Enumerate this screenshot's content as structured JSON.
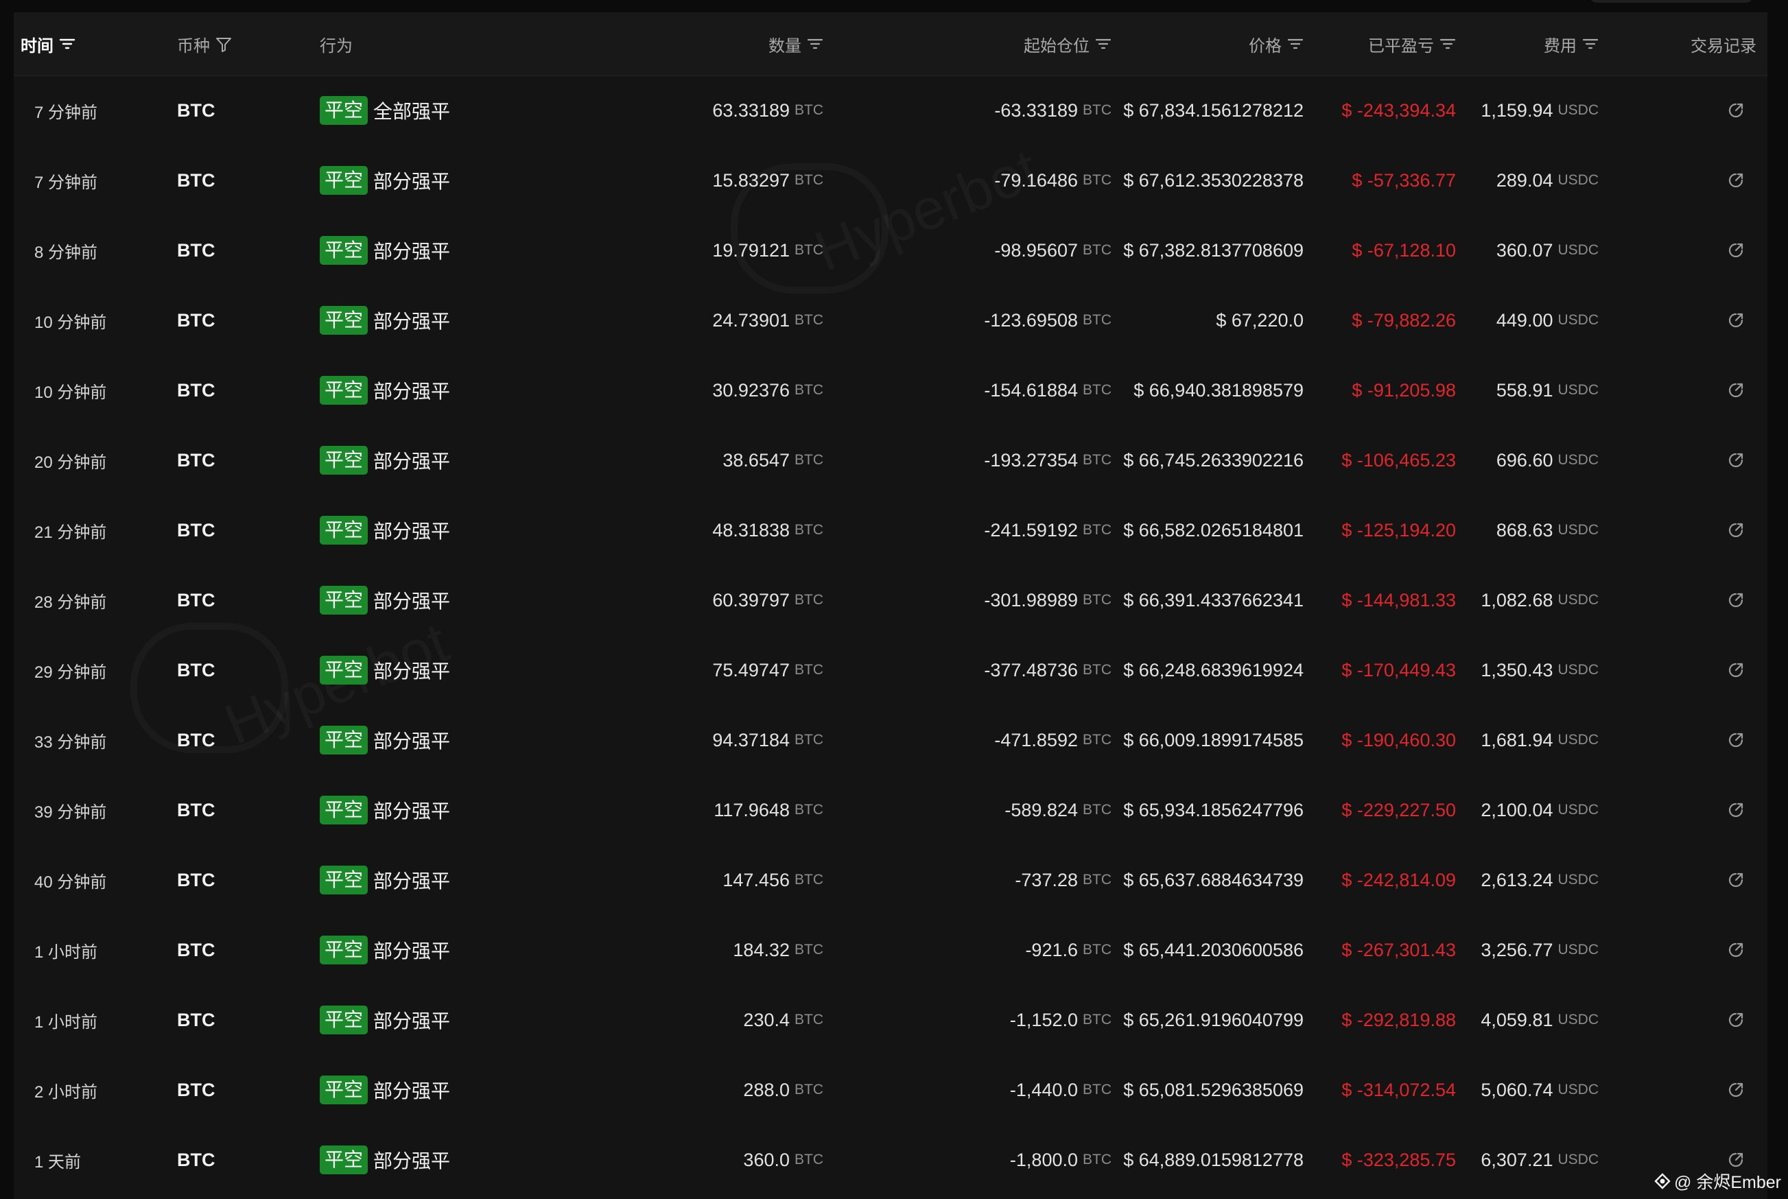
{
  "header": {
    "time": "时间",
    "coin": "币种",
    "action": "行为",
    "qty": "数量",
    "start_pos": "起始仓位",
    "price": "价格",
    "pnl": "已平盈亏",
    "fee": "费用",
    "trade_log": "交易记录"
  },
  "rows": [
    {
      "time": "7 分钟前",
      "coin": "BTC",
      "badge": "平空",
      "action": "全部强平",
      "qty": "63.33189",
      "qty_unit": "BTC",
      "start": "-63.33189",
      "start_unit": "BTC",
      "price": "$ 67,834.1561278212",
      "pnl": "$ -243,394.34",
      "fee": "1,159.94",
      "fee_unit": "USDC"
    },
    {
      "time": "7 分钟前",
      "coin": "BTC",
      "badge": "平空",
      "action": "部分强平",
      "qty": "15.83297",
      "qty_unit": "BTC",
      "start": "-79.16486",
      "start_unit": "BTC",
      "price": "$ 67,612.3530228378",
      "pnl": "$ -57,336.77",
      "fee": "289.04",
      "fee_unit": "USDC"
    },
    {
      "time": "8 分钟前",
      "coin": "BTC",
      "badge": "平空",
      "action": "部分强平",
      "qty": "19.79121",
      "qty_unit": "BTC",
      "start": "-98.95607",
      "start_unit": "BTC",
      "price": "$ 67,382.8137708609",
      "pnl": "$ -67,128.10",
      "fee": "360.07",
      "fee_unit": "USDC"
    },
    {
      "time": "10 分钟前",
      "coin": "BTC",
      "badge": "平空",
      "action": "部分强平",
      "qty": "24.73901",
      "qty_unit": "BTC",
      "start": "-123.69508",
      "start_unit": "BTC",
      "price": "$ 67,220.0",
      "pnl": "$ -79,882.26",
      "fee": "449.00",
      "fee_unit": "USDC"
    },
    {
      "time": "10 分钟前",
      "coin": "BTC",
      "badge": "平空",
      "action": "部分强平",
      "qty": "30.92376",
      "qty_unit": "BTC",
      "start": "-154.61884",
      "start_unit": "BTC",
      "price": "$ 66,940.381898579",
      "pnl": "$ -91,205.98",
      "fee": "558.91",
      "fee_unit": "USDC"
    },
    {
      "time": "20 分钟前",
      "coin": "BTC",
      "badge": "平空",
      "action": "部分强平",
      "qty": "38.6547",
      "qty_unit": "BTC",
      "start": "-193.27354",
      "start_unit": "BTC",
      "price": "$ 66,745.2633902216",
      "pnl": "$ -106,465.23",
      "fee": "696.60",
      "fee_unit": "USDC"
    },
    {
      "time": "21 分钟前",
      "coin": "BTC",
      "badge": "平空",
      "action": "部分强平",
      "qty": "48.31838",
      "qty_unit": "BTC",
      "start": "-241.59192",
      "start_unit": "BTC",
      "price": "$ 66,582.0265184801",
      "pnl": "$ -125,194.20",
      "fee": "868.63",
      "fee_unit": "USDC"
    },
    {
      "time": "28 分钟前",
      "coin": "BTC",
      "badge": "平空",
      "action": "部分强平",
      "qty": "60.39797",
      "qty_unit": "BTC",
      "start": "-301.98989",
      "start_unit": "BTC",
      "price": "$ 66,391.4337662341",
      "pnl": "$ -144,981.33",
      "fee": "1,082.68",
      "fee_unit": "USDC"
    },
    {
      "time": "29 分钟前",
      "coin": "BTC",
      "badge": "平空",
      "action": "部分强平",
      "qty": "75.49747",
      "qty_unit": "BTC",
      "start": "-377.48736",
      "start_unit": "BTC",
      "price": "$ 66,248.6839619924",
      "pnl": "$ -170,449.43",
      "fee": "1,350.43",
      "fee_unit": "USDC"
    },
    {
      "time": "33 分钟前",
      "coin": "BTC",
      "badge": "平空",
      "action": "部分强平",
      "qty": "94.37184",
      "qty_unit": "BTC",
      "start": "-471.8592",
      "start_unit": "BTC",
      "price": "$ 66,009.1899174585",
      "pnl": "$ -190,460.30",
      "fee": "1,681.94",
      "fee_unit": "USDC"
    },
    {
      "time": "39 分钟前",
      "coin": "BTC",
      "badge": "平空",
      "action": "部分强平",
      "qty": "117.9648",
      "qty_unit": "BTC",
      "start": "-589.824",
      "start_unit": "BTC",
      "price": "$ 65,934.1856247796",
      "pnl": "$ -229,227.50",
      "fee": "2,100.04",
      "fee_unit": "USDC"
    },
    {
      "time": "40 分钟前",
      "coin": "BTC",
      "badge": "平空",
      "action": "部分强平",
      "qty": "147.456",
      "qty_unit": "BTC",
      "start": "-737.28",
      "start_unit": "BTC",
      "price": "$ 65,637.6884634739",
      "pnl": "$ -242,814.09",
      "fee": "2,613.24",
      "fee_unit": "USDC"
    },
    {
      "time": "1 小时前",
      "coin": "BTC",
      "badge": "平空",
      "action": "部分强平",
      "qty": "184.32",
      "qty_unit": "BTC",
      "start": "-921.6",
      "start_unit": "BTC",
      "price": "$ 65,441.2030600586",
      "pnl": "$ -267,301.43",
      "fee": "3,256.77",
      "fee_unit": "USDC"
    },
    {
      "time": "1 小时前",
      "coin": "BTC",
      "badge": "平空",
      "action": "部分强平",
      "qty": "230.4",
      "qty_unit": "BTC",
      "start": "-1,152.0",
      "start_unit": "BTC",
      "price": "$ 65,261.9196040799",
      "pnl": "$ -292,819.88",
      "fee": "4,059.81",
      "fee_unit": "USDC"
    },
    {
      "time": "2 小时前",
      "coin": "BTC",
      "badge": "平空",
      "action": "部分强平",
      "qty": "288.0",
      "qty_unit": "BTC",
      "start": "-1,440.0",
      "start_unit": "BTC",
      "price": "$ 65,081.5296385069",
      "pnl": "$ -314,072.54",
      "fee": "5,060.74",
      "fee_unit": "USDC"
    },
    {
      "time": "1 天前",
      "coin": "BTC",
      "badge": "平空",
      "action": "部分强平",
      "qty": "360.0",
      "qty_unit": "BTC",
      "start": "-1,800.0",
      "start_unit": "BTC",
      "price": "$ 64,889.0159812778",
      "pnl": "$ -323,285.75",
      "fee": "6,307.21",
      "fee_unit": "USDC"
    }
  ],
  "watermark": "Hyperbot",
  "credit": "@ 余烬Ember",
  "colors": {
    "background": "#0b0b0b",
    "table": "#141414",
    "badge_green": "#1a8a2a",
    "loss_red": "#e0262b",
    "unit_gray": "#8c8c8c"
  },
  "icons": {
    "sort": "sort-lines-icon",
    "filter": "filter-funnel-icon",
    "trade_link": "external-link-icon",
    "weibo": "weibo-logo-icon"
  }
}
